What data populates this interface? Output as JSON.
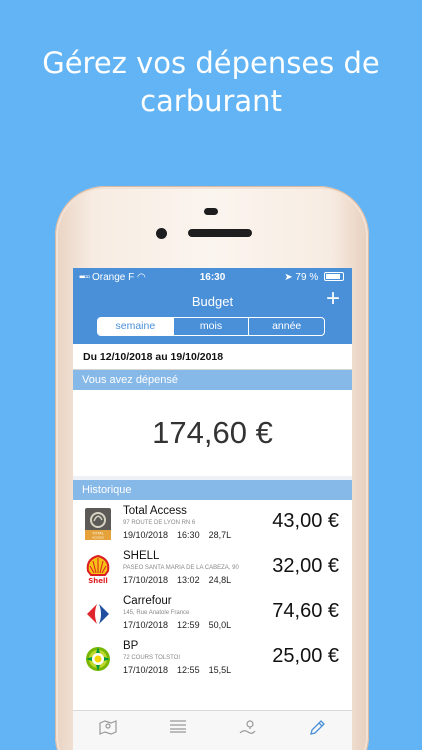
{
  "promo": {
    "headline": "Gérez vos dépenses de carburant"
  },
  "status_bar": {
    "carrier": "Orange F",
    "time": "16:30",
    "battery": "79 %"
  },
  "nav": {
    "title": "Budget",
    "add_label": "+",
    "segments": [
      "semaine",
      "mois",
      "année"
    ],
    "selected_segment": "semaine"
  },
  "period": "Du 12/10/2018 au 19/10/2018",
  "spent": {
    "header": "Vous avez dépensé",
    "amount": "174,60 €"
  },
  "history": {
    "header": "Historique",
    "items": [
      {
        "name": "Total Access",
        "address": "97 ROUTE DE LYON RN 6",
        "date": "19/10/2018",
        "time": "16:30",
        "volume": "28,7L",
        "amount": "43,00 €",
        "logo": "total-logo"
      },
      {
        "name": "SHELL",
        "address": "PASEO SANTA MARIA DE LA CABEZA, 90",
        "date": "17/10/2018",
        "time": "13:02",
        "volume": "24,8L",
        "amount": "32,00 €",
        "logo": "shell-logo"
      },
      {
        "name": "Carrefour",
        "address": "145, Rue Anatole France",
        "date": "17/10/2018",
        "time": "12:59",
        "volume": "50,0L",
        "amount": "74,60 €",
        "logo": "carrefour-logo"
      },
      {
        "name": "BP",
        "address": "72 COURS TOLSTOI",
        "date": "17/10/2018",
        "time": "12:55",
        "volume": "15,5L",
        "amount": "25,00 €",
        "logo": "bp-logo"
      }
    ]
  },
  "logo_text": {
    "total": "TOTAL",
    "total_sub": "ACCESS",
    "shell": "Shell"
  },
  "tabs": [
    {
      "icon": "map-icon"
    },
    {
      "icon": "list-icon"
    },
    {
      "icon": "route-icon"
    },
    {
      "icon": "pencil-icon"
    }
  ],
  "colors": {
    "background": "#62b4f5",
    "nav": "#4a90d9",
    "section_header": "#86b8e8",
    "active_tab": "#4a90d9"
  }
}
